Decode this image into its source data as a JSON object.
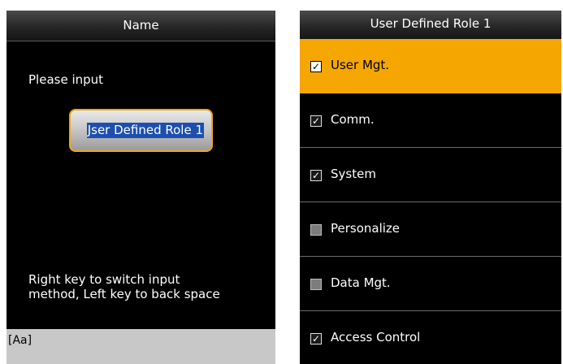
{
  "left_screen": {
    "title": "Name",
    "prompt": "Please input",
    "input_value": "Jser Defined Role 1",
    "hint_line1": "Right key to switch input",
    "hint_line2": "method, Left key to back space",
    "input_mode": "[Aa]"
  },
  "right_screen": {
    "title": "User Defined Role 1",
    "items": [
      {
        "label": "User Mgt.",
        "checked": true,
        "selected": true
      },
      {
        "label": "Comm.",
        "checked": true,
        "selected": false
      },
      {
        "label": "System",
        "checked": true,
        "selected": false
      },
      {
        "label": "Personalize",
        "checked": false,
        "selected": false
      },
      {
        "label": "Data Mgt.",
        "checked": false,
        "selected": false
      },
      {
        "label": "Access Control",
        "checked": true,
        "selected": false
      }
    ],
    "check_mark": "✓"
  },
  "colors": {
    "highlight": "#f5a600",
    "input_border": "#f0a520",
    "text_selection": "#1c4fb0"
  }
}
